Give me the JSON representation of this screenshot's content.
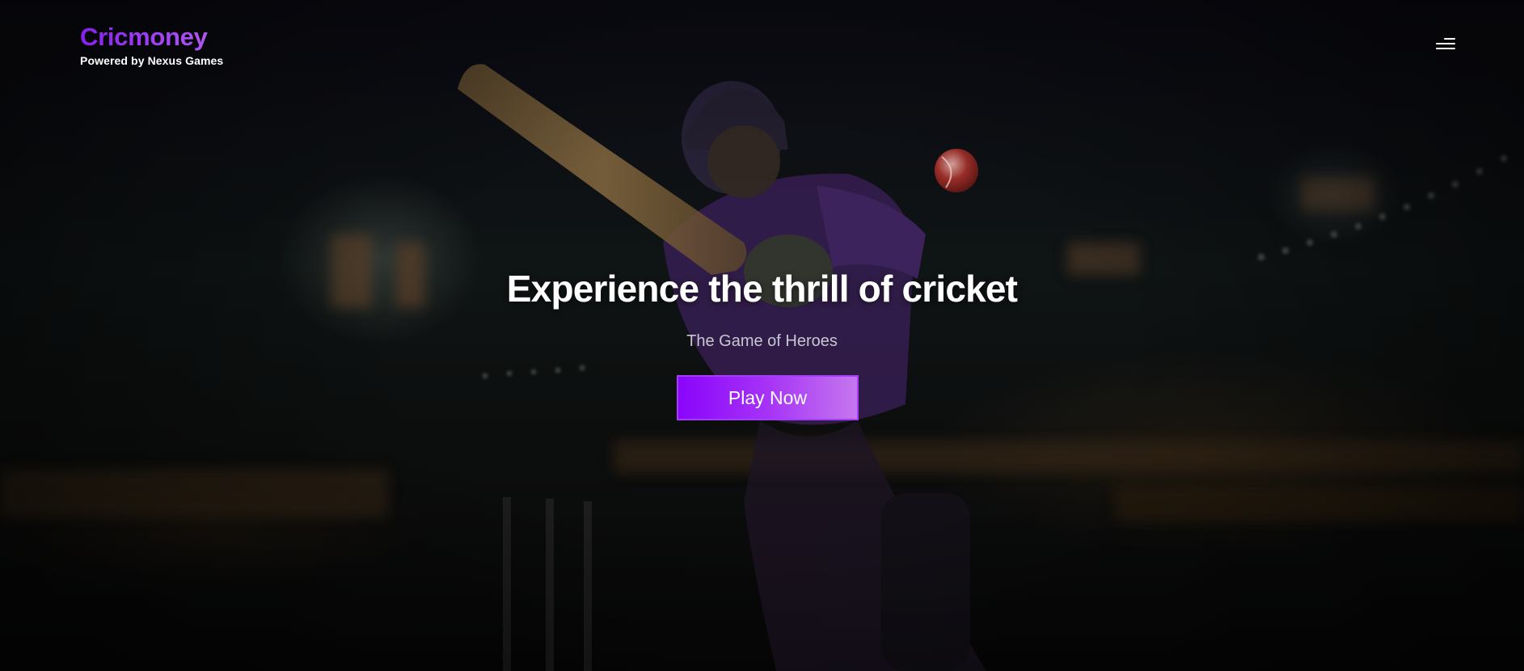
{
  "header": {
    "brand": "Cricmoney",
    "tagline": "Powered by Nexus Games"
  },
  "hero": {
    "title": "Experience the thrill of cricket",
    "subtitle": "The Game of Heroes",
    "cta_label": "Play Now",
    "background_image": "cricket batsman in purple jersey swinging bat at night stadium"
  },
  "colors": {
    "brand_gradient_start": "#8a1ff3",
    "brand_gradient_end": "#b35ef0",
    "cta_start": "#8a05fb",
    "cta_end": "#c577ee",
    "background": "#07070c"
  },
  "icons": {
    "menu": "hamburger-menu-icon"
  }
}
